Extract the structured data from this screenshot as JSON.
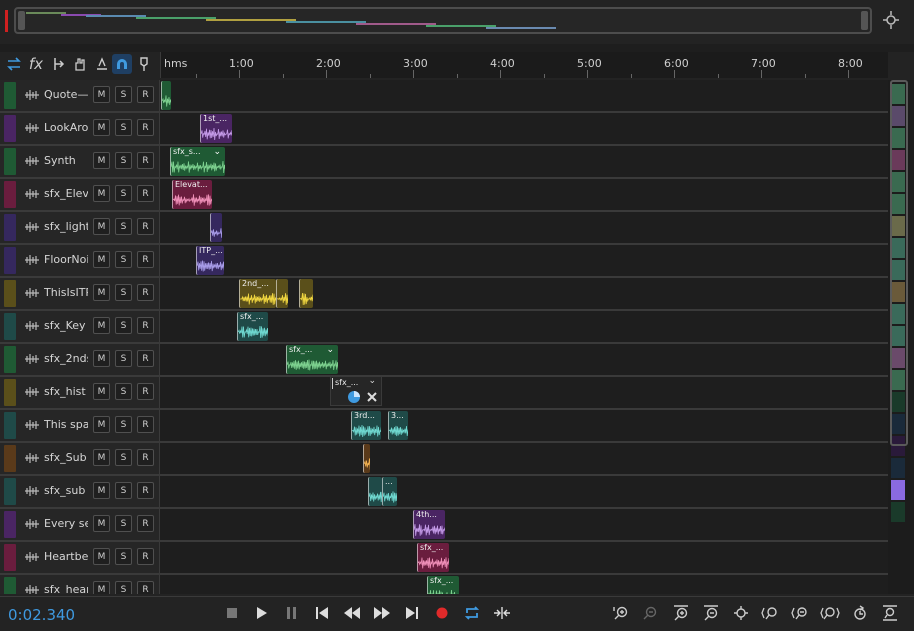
{
  "overview": {
    "label": "Session overview"
  },
  "toolbar": {
    "icons": [
      "swap-icon",
      "fx-icon",
      "move-tool-icon",
      "hand-tool-icon",
      "slip-tool-icon",
      "snap-magnet-icon",
      "marker-icon"
    ],
    "fx_label": "fx"
  },
  "ruler": {
    "unit_label": "hms",
    "ticks": [
      "1:00",
      "2:00",
      "3:00",
      "4:00",
      "5:00",
      "6:00",
      "7:00",
      "8:00"
    ]
  },
  "buttons": {
    "mute": "M",
    "solo": "S",
    "record": "R"
  },
  "tracks": [
    {
      "name": "Quote—",
      "color": "#1f5a34",
      "clips": [
        {
          "label": "",
          "color": "#1f5a34"
        }
      ]
    },
    {
      "name": "LookAro",
      "color": "#4a2563",
      "clips": [
        {
          "label": "1st_...",
          "color": "#4a2563"
        }
      ]
    },
    {
      "name": "Synth",
      "color": "#1f5a34",
      "clips": [
        {
          "label": "sfx_s...",
          "color": "#1f5a34"
        }
      ]
    },
    {
      "name": "sfx_Elev",
      "color": "#6a1d3e",
      "clips": [
        {
          "label": "Elevat...",
          "color": "#6a1d3e"
        }
      ]
    },
    {
      "name": "sfx_light",
      "color": "#35285e",
      "clips": [
        {
          "label": "",
          "color": "#35285e"
        }
      ]
    },
    {
      "name": "FloorNoi",
      "color": "#35285e",
      "clips": [
        {
          "label": "ITP_...",
          "color": "#35285e"
        }
      ]
    },
    {
      "name": "ThisIsITP",
      "color": "#5a4f1a",
      "clips": [
        {
          "label": "2nd_...",
          "color": "#5a4f1a"
        },
        {
          "label": "",
          "color": "#5a4f1a"
        },
        {
          "label": "",
          "color": "#5a4f1a"
        }
      ]
    },
    {
      "name": "sfx_Key",
      "color": "#1f4a48",
      "clips": [
        {
          "label": "sfx_...",
          "color": "#1f4a48"
        }
      ]
    },
    {
      "name": "sfx_2nds",
      "color": "#1f5a34",
      "clips": [
        {
          "label": "sfx_...",
          "color": "#1f5a34"
        }
      ]
    },
    {
      "name": "sfx_hist",
      "color": "#5a4f1a",
      "clips": [
        {
          "label": "sfx_...",
          "color": "#2a2a2a"
        }
      ]
    },
    {
      "name": "This spa",
      "color": "#1f4a48",
      "clips": [
        {
          "label": "3rd...",
          "color": "#1f4a48"
        },
        {
          "label": "3...",
          "color": "#1f4a48"
        }
      ]
    },
    {
      "name": "sfx_Sub",
      "color": "#5a3a1a",
      "clips": [
        {
          "label": "",
          "color": "#5a3a1a"
        }
      ]
    },
    {
      "name": "sfx_sub",
      "color": "#1f4a48",
      "clips": [
        {
          "label": "",
          "color": "#1f4a48"
        },
        {
          "label": "...",
          "color": "#1f4a48"
        }
      ]
    },
    {
      "name": "Every se",
      "color": "#4a2563",
      "clips": [
        {
          "label": "4th...",
          "color": "#4a2563"
        }
      ]
    },
    {
      "name": "Heartbe",
      "color": "#6a1d3e",
      "clips": [
        {
          "label": "sfx_...",
          "color": "#6a1d3e"
        }
      ]
    },
    {
      "name": "sfx_hear",
      "color": "#1f5a34",
      "clips": [
        {
          "label": "sfx_...",
          "color": "#1f5a34"
        }
      ]
    }
  ],
  "scroll_swatches": [
    "#3a6a50",
    "#5a4a6a",
    "#3a6a50",
    "#6a3a5a",
    "#3a6a50",
    "#3a6a50",
    "#6a6a4a",
    "#3a6a5a",
    "#3a6a5a",
    "#6a5a3a",
    "#3a6a5a",
    "#3a6a5a",
    "#6a4a6a",
    "#3a6a50",
    "#1a3a2a",
    "#1a2a3a",
    "#2a1a3a",
    "#1a2a3a",
    "#8a6ae0",
    "#1a3a2a"
  ],
  "transport": {
    "time": "0:02.340",
    "accent": "#3f9ae0",
    "record_color": "#e02a2a"
  }
}
